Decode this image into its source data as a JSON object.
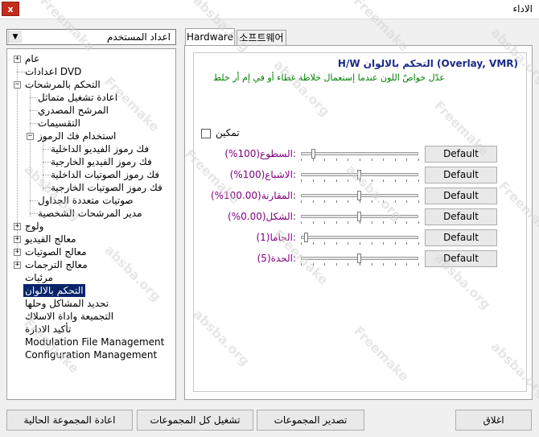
{
  "window": {
    "title": "الاداء",
    "close_label": "x"
  },
  "profile": {
    "selected": "اعداد المستخدم"
  },
  "tree": {
    "items": [
      {
        "label": "عام"
      },
      {
        "label": "اعدادات DVD"
      },
      {
        "label": "التحكم بالمرشحات"
      },
      {
        "label": "اعادة تشغيل متماثل"
      },
      {
        "label": "المرشح المصدري"
      },
      {
        "label": "التقسيمات"
      },
      {
        "label": "استخدام فك الرموز"
      },
      {
        "label": "فك رموز الفيديو الداخلية"
      },
      {
        "label": "فك رموز الفيديو الخارجية"
      },
      {
        "label": "فك رموز الصوتيات الداخلية"
      },
      {
        "label": "فك رموز الصوتيات الخارجية"
      },
      {
        "label": "صوتيات متعددة الجداول"
      },
      {
        "label": "مدير المرشحات الشخصية"
      },
      {
        "label": "ولوج"
      },
      {
        "label": "معالج الفيديو"
      },
      {
        "label": "معالج الصوتيات"
      },
      {
        "label": "معالج الترجمات"
      },
      {
        "label": "مرئيات"
      },
      {
        "label": "التحكم بالالوان"
      },
      {
        "label": "تحديد المشاكل وحلها"
      },
      {
        "label": "التجميعة واداة الاسلاك"
      },
      {
        "label": "تأكيد الادارة"
      },
      {
        "label": "Modulation File Management"
      },
      {
        "label": "Configuration Management"
      }
    ]
  },
  "tabs": [
    {
      "label": "Hardware"
    },
    {
      "label": "소프트웨어"
    }
  ],
  "panel": {
    "title": "H/W التحكم بالالوان (Overlay, VMR)",
    "description": "عدّل خواصّ اللون عندما إستعمال خلاطة غطاء أو في إم أر خلط",
    "enable_label": "تمكين",
    "params": [
      {
        "label": "السطوع(100%):",
        "value": 0.09,
        "default_label": "Default"
      },
      {
        "label": "الاشباع(100%):",
        "value": 0.5,
        "default_label": "Default"
      },
      {
        "label": "المقارنة(100.00%):",
        "value": 0.5,
        "default_label": "Default"
      },
      {
        "label": "الشكل(0.00%):",
        "value": 0.5,
        "default_label": "Default"
      },
      {
        "label": "الجاما(1):",
        "value": 0.03,
        "default_label": "Default"
      },
      {
        "label": "الحدة(5):",
        "value": 0.5,
        "default_label": "Default"
      }
    ]
  },
  "footer": {
    "reset_group": "اعادة المجموعة الحالية",
    "run_all": "تشغيل كل المجموعات",
    "export": "تصدير المجموعات",
    "close": "اغلاق"
  },
  "watermark": {
    "text": "Freemake",
    "subtext": "absba.org"
  },
  "colors": {
    "selection": "#0a246a",
    "param_label": "#800080",
    "description": "#008000",
    "title": "#1a2a8a",
    "close": "#c42b1c"
  }
}
